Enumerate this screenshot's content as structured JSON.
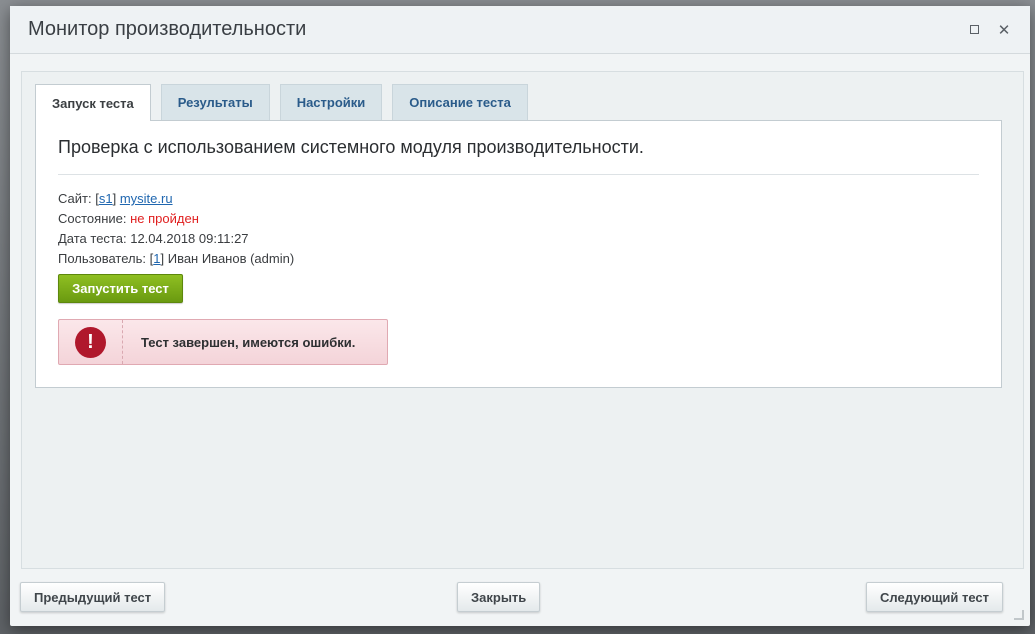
{
  "window": {
    "title": "Монитор производительности"
  },
  "tabs": [
    {
      "label": "Запуск теста",
      "active": true
    },
    {
      "label": "Результаты",
      "active": false
    },
    {
      "label": "Настройки",
      "active": false
    },
    {
      "label": "Описание теста",
      "active": false
    }
  ],
  "panel": {
    "heading": "Проверка с использованием системного модуля производительности.",
    "site": {
      "label": "Сайт:",
      "id_open": "[",
      "id": "s1",
      "id_close": "]",
      "url": "mysite.ru"
    },
    "status": {
      "label": "Состояние:",
      "value": "не пройден"
    },
    "date": {
      "label": "Дата теста:",
      "value": "12.04.2018 09:11:27"
    },
    "user": {
      "label": "Пользователь:",
      "id_open": "[",
      "id": "1",
      "id_close": "]",
      "name": "Иван Иванов (admin)"
    },
    "run_button": "Запустить тест",
    "alert": {
      "icon_glyph": "!",
      "message": "Тест завершен, имеются ошибки."
    }
  },
  "footer": {
    "prev_button": "Предыдущий тест",
    "close_button": "Закрыть",
    "next_button": "Следующий тест"
  },
  "colors": {
    "accent_green": "#7aab18",
    "error_red": "#e01f1f",
    "link_blue": "#2067b0",
    "alert_icon": "#b0182c"
  },
  "icons": {
    "maximize": "maximize-icon",
    "close": "close-icon",
    "alert": "exclamation-icon"
  }
}
